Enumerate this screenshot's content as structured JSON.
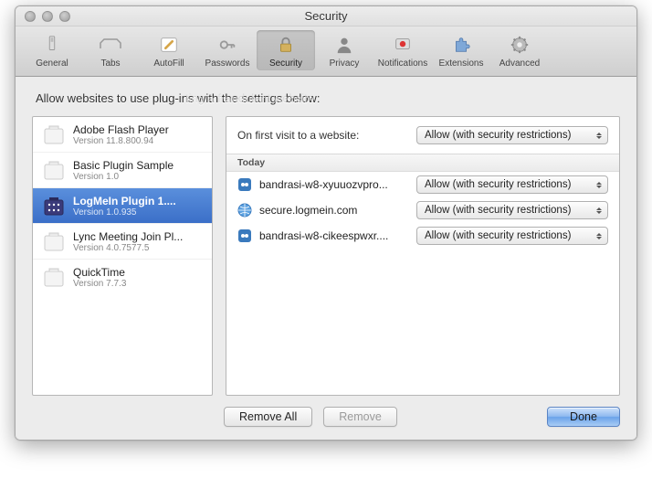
{
  "window": {
    "title": "Security"
  },
  "toolbar": {
    "items": [
      {
        "label": "General"
      },
      {
        "label": "Tabs"
      },
      {
        "label": "AutoFill"
      },
      {
        "label": "Passwords"
      },
      {
        "label": "Security"
      },
      {
        "label": "Privacy"
      },
      {
        "label": "Notifications"
      },
      {
        "label": "Extensions"
      },
      {
        "label": "Advanced"
      }
    ],
    "selected_index": 4
  },
  "instruction": "Allow websites to use plug-ins with the settings below:",
  "instruction_ghost": "ting a fraudulent website",
  "plugins": [
    {
      "name": "Adobe Flash Player",
      "version": "Version 11.8.800.94",
      "icon": "plugin-generic"
    },
    {
      "name": "Basic Plugin Sample",
      "version": "Version 1.0",
      "icon": "plugin-generic"
    },
    {
      "name": "LogMeIn Plugin 1....",
      "version": "Version 1.0.935",
      "icon": "plugin-logmein"
    },
    {
      "name": "Lync Meeting Join Pl...",
      "version": "Version 4.0.7577.5",
      "icon": "plugin-generic"
    },
    {
      "name": "QuickTime",
      "version": "Version 7.7.3",
      "icon": "plugin-generic"
    }
  ],
  "plugins_selected_index": 2,
  "detail": {
    "first_visit_label": "On first visit to a website:",
    "first_visit_value": "Allow (with security restrictions)",
    "sections": [
      {
        "label": "Today",
        "sites": [
          {
            "name": "bandrasi-w8-xyuuozvpro...",
            "icon": "favicon-blue",
            "value": "Allow (with security restrictions)"
          },
          {
            "name": "secure.logmein.com",
            "icon": "favicon-globe",
            "value": "Allow (with security restrictions)"
          },
          {
            "name": "bandrasi-w8-cikeespwxr....",
            "icon": "favicon-blue",
            "value": "Allow (with security restrictions)"
          }
        ]
      }
    ]
  },
  "buttons": {
    "remove_all": "Remove All",
    "remove": "Remove",
    "done": "Done"
  }
}
